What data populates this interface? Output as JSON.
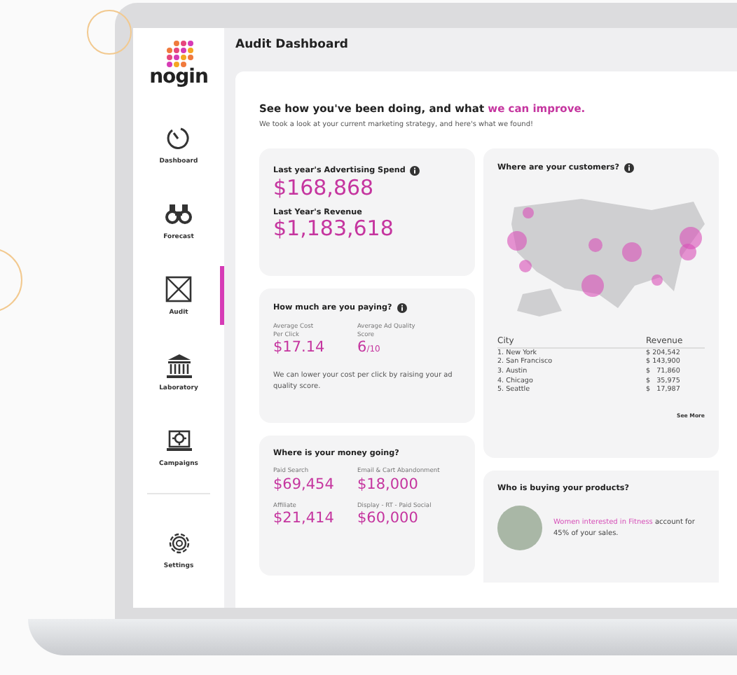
{
  "app": {
    "logo": "nogin",
    "page_title": "Audit Dashboard"
  },
  "sidebar": {
    "items": [
      {
        "label": "Dashboard",
        "kind": "gauge",
        "selected": false
      },
      {
        "label": "Forecast",
        "kind": "binoculars",
        "selected": false
      },
      {
        "label": "Audit",
        "kind": "crossbox",
        "selected": true
      },
      {
        "label": "Laboratory",
        "kind": "bank",
        "selected": false
      },
      {
        "label": "Campaigns",
        "kind": "laptop",
        "selected": false
      },
      {
        "label": "Settings",
        "kind": "gear",
        "selected": false
      }
    ]
  },
  "intro": {
    "headline": "See how you've been doing, and what",
    "headline_highlight": "we can improve.",
    "subtitle": "We took a look at your current marketing strategy, and here's what we found!"
  },
  "spend_card": {
    "spend_label": "Last year's Advertising Spend",
    "spend_value": "$168,868",
    "revenue_label": "Last Year's Revenue",
    "revenue_value": "$1,183,618"
  },
  "paying_card": {
    "title": "How much are you paying?",
    "cpc_label": "Average Cost Per Click",
    "cpc_value": "$17.14",
    "score_label": "Average Ad Quality Score",
    "score_value": "6",
    "score_scale": "/10",
    "note": "We can lower your cost per click by raising your ad quality score."
  },
  "money_card": {
    "title": "Where is your money going?",
    "channels": [
      {
        "label": "Paid Search",
        "value": "$69,454"
      },
      {
        "label": "Email & Cart Abandonment",
        "value": "$18,000"
      },
      {
        "label": "Affiliate",
        "value": "$21,414"
      },
      {
        "label": "Display - RT - Paid Social",
        "value": "$60,000"
      }
    ]
  },
  "customers_card": {
    "title": "Where are your customers?",
    "columns": [
      "City",
      "Revenue"
    ],
    "rows": [
      [
        "1. New York",
        "$ 204,542"
      ],
      [
        "2. San Francisco",
        "$ 143,900"
      ],
      [
        "3. Austin",
        "$   71,860"
      ],
      [
        "4. Chicago",
        "$   35,975"
      ],
      [
        "5. Seattle",
        "$   17,987"
      ]
    ],
    "see_more": "See More"
  },
  "buyers_card": {
    "title": "Who is buying your products?",
    "highlight": "Women interested in Fitness",
    "rest": "account for 45% of your sales."
  }
}
